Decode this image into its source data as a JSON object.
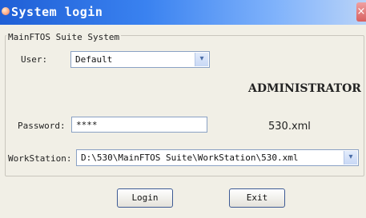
{
  "window": {
    "title": "System login",
    "close_glyph": "×",
    "icon": "app-icon"
  },
  "group": {
    "title": "MainFTOS Suite System"
  },
  "user": {
    "label": "User:",
    "value": "Default"
  },
  "role": {
    "text": "ADMINISTRATOR"
  },
  "password": {
    "label": "Password:",
    "value": "****"
  },
  "config": {
    "text": "530.xml"
  },
  "workstation": {
    "label": "WorkStation:",
    "value": "D:\\530\\MainFTOS Suite\\WorkStation\\530.xml"
  },
  "buttons": {
    "login": "Login",
    "exit": "Exit"
  },
  "dropdown_glyph": "▾",
  "colors": {
    "titlebar_start": "#1f5fd6",
    "titlebar_end": "#b9d3f8",
    "field_border": "#8aa1c4",
    "button_border": "#3d5a94"
  }
}
